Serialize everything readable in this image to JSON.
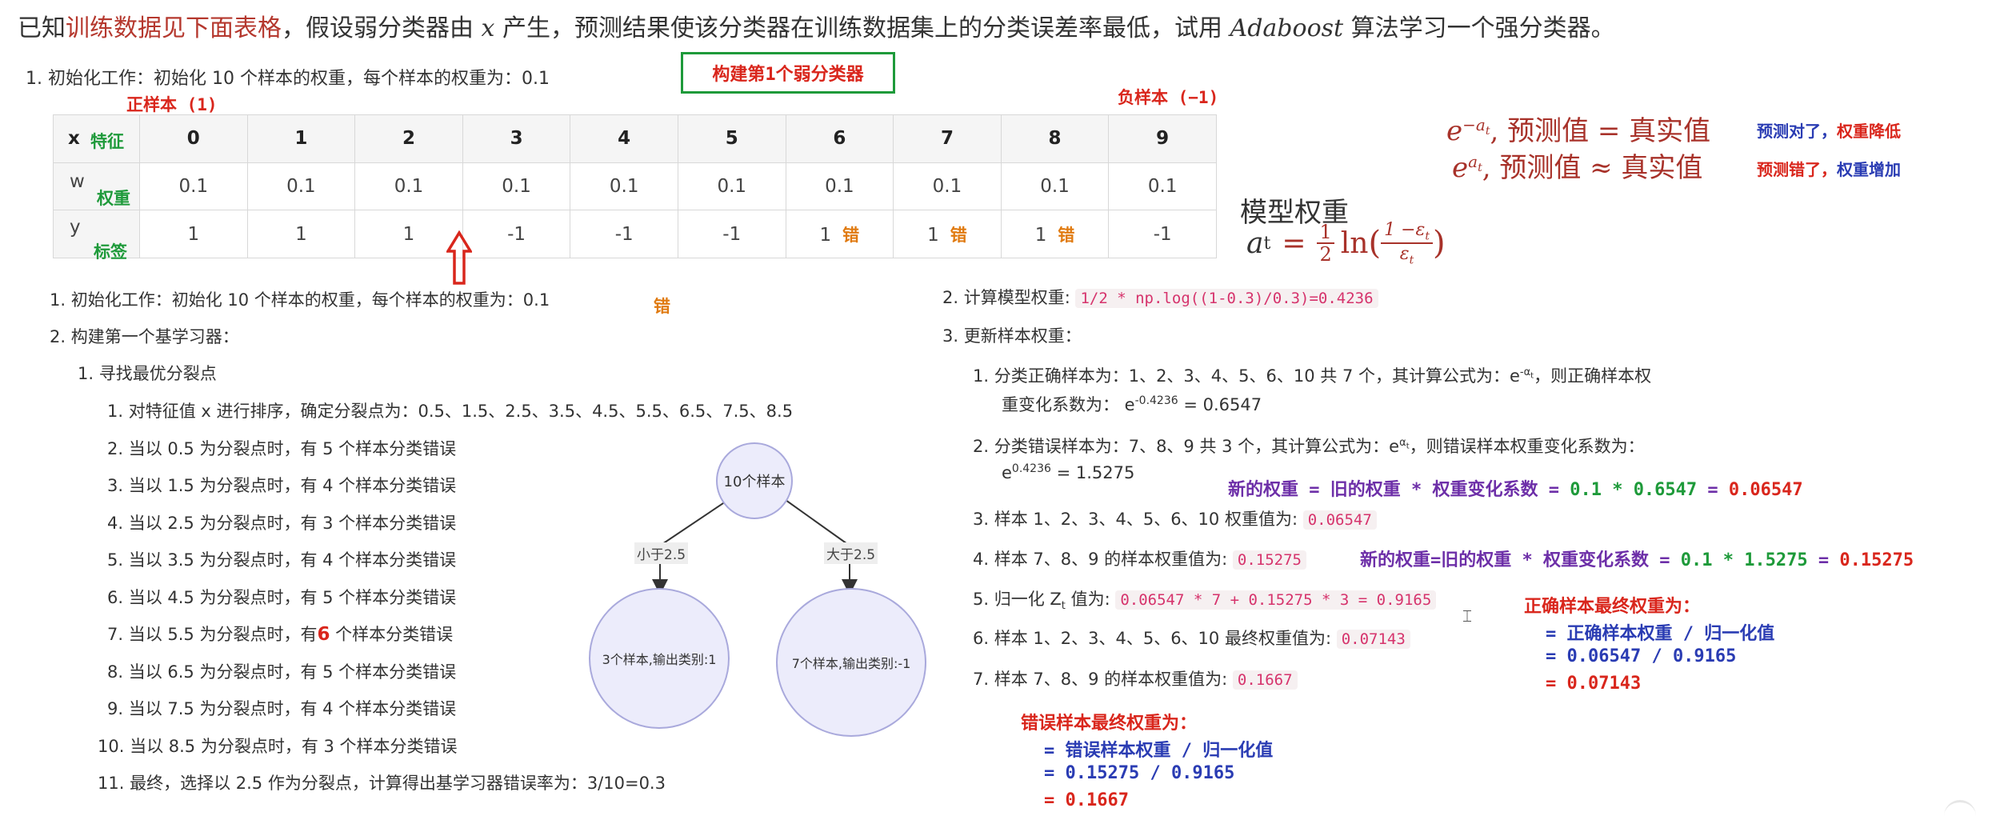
{
  "title": {
    "prefix": "已知",
    "highlight": "训练数据见下面表格",
    "mid": "，假设弱分类器由 ",
    "var": "x",
    "suffix": " 产生，预测结果使该分类器在训练数据集上的分类误差率最低，试用 ",
    "algo": "Adaboost",
    "end": " 算法学习一个强分类器。"
  },
  "init_line": "1.  初始化工作：初始化 10 个样本的权重，每个样本的权重为：0.1",
  "box_label": "构建第1个弱分类器",
  "pos_sample": "正样本 (1)",
  "neg_sample": "负样本 (−1)",
  "table": {
    "row_heads": [
      {
        "sym": "x",
        "label": "特征"
      },
      {
        "sym": "w",
        "label": "权重"
      },
      {
        "sym": "y",
        "label": "标签"
      }
    ],
    "x": [
      "0",
      "1",
      "2",
      "3",
      "4",
      "5",
      "6",
      "7",
      "8",
      "9"
    ],
    "w": [
      "0.1",
      "0.1",
      "0.1",
      "0.1",
      "0.1",
      "0.1",
      "0.1",
      "0.1",
      "0.1",
      "0.1"
    ],
    "y": [
      "1",
      "1",
      "1",
      "-1",
      "-1",
      "-1",
      "1",
      "1",
      "1",
      "-1"
    ],
    "wrong_mark": "错"
  },
  "stray_wrong": "错",
  "left_steps": {
    "s1": "1.  初始化工作：初始化 10 个样本的权重，每个样本的权重为：0.1",
    "s2": "2.  构建第一个基学习器：",
    "s2_1": "1.  寻找最优分裂点",
    "items": [
      "1.  对特征值 x 进行排序，确定分裂点为：0.5、1.5、2.5、3.5、4.5、5.5、6.5、7.5、8.5",
      "2.  当以 0.5 为分裂点时，有 5 个样本分类错误",
      "3.  当以 1.5 为分裂点时，有 4 个样本分类错误",
      "4.  当以 2.5 为分裂点时，有 3 个样本分类错误",
      "5.  当以 3.5 为分裂点时，有 4 个样本分类错误",
      "6.  当以 4.5 为分裂点时，有 5 个样本分类错误",
      "7.  当以 5.5 为分裂点时，有",
      "8.  当以 6.5 为分裂点时，有 5 个样本分类错误",
      "9.  当以 7.5 为分裂点时，有 4 个样本分类错误",
      "10.  当以 8.5 为分裂点时，有 3 个样本分类错误",
      "11.  最终，选择以 2.5 作为分裂点，计算得出基学习器错误率为：3/10=0.3"
    ],
    "item7_num": "6",
    "item7_rest": " 个样本分类错误"
  },
  "tree": {
    "root": "10个样本",
    "left_edge": "小于2.5",
    "right_edge": "大于2.5",
    "left_leaf": "3个样本,输出类别:1",
    "right_leaf": "7个样本,输出类别:-1"
  },
  "weight_rules": {
    "r1_expr": "e",
    "r1_sup": "−a",
    "r1_sub": "t",
    "r1_text": ", 预测值 = 真实值",
    "r1_note_a": "预测对了，",
    "r1_note_b": "权重降低",
    "r2_expr": "e",
    "r2_sup": "a",
    "r2_sub": "t",
    "r2_text": ", 预测值 ≈ 真实值",
    "r2_note_a": "预测错了，",
    "r2_note_b": "权重增加"
  },
  "model_weight": {
    "label": "模型权重",
    "lhs": "a",
    "lhs_sub": "t",
    "eq": "=",
    "half_num": "1",
    "half_den": "2",
    "ln": "ln",
    "frac_num": "1 −ε",
    "frac_num_sub": "t",
    "frac_den": "ε",
    "frac_den_sub": "t"
  },
  "right_steps": {
    "s2": "2.  计算模型权重:",
    "s2_code": "1/2 * np.log((1-0.3)/0.3)=0.4236",
    "s3": "3.  更新样本权重：",
    "i1_a": "1.  分类正确样本为：1、2、3、4、5、6、10 共 7 个，其计算公式为：e",
    "i1_sup": "-α",
    "i1_sub": "t",
    "i1_b": "，则正确样本权",
    "i1_c": "重变化系数为：  e",
    "i1_c_sup": "-0.4236",
    "i1_c_end": " = 0.6547",
    "i2_a": "2.  分类错误样本为：7、8、9 共 3 个，其计算公式为：e",
    "i2_sup": "α",
    "i2_sub": "t",
    "i2_b": "，则错误样本权重变化系数为：",
    "i2_c": "e",
    "i2_c_sup": "0.4236",
    "i2_c_end": " = 1.5275",
    "i3": "3.  样本 1、2、3、4、5、6、10  权重值为:",
    "i3_code": "0.06547",
    "i4": "4.  样本 7、8、9 的样本权重值为:",
    "i4_code": "0.15275",
    "i5": "5.  归一化 Z",
    "i5_sub": "t",
    "i5_b": " 值为:",
    "i5_code": "0.06547 * 7 + 0.15275 * 3 = 0.9165",
    "i6": "6.  样本 1、2、3、4、5、6、10  最终权重值为:",
    "i6_code": "0.07143",
    "i7": "7.  样本 7、8、9 的样本权重值为:",
    "i7_code": "0.1667"
  },
  "notes": {
    "n1_a": "新的权重 = 旧的权重 * 权重变化系数 = ",
    "n1_b": "0.1 * 0.6547",
    "n1_c": " = ",
    "n1_d": "0.06547",
    "n2_a": "新的权重=旧的权重 * 权重变化系数 = ",
    "n2_b": "0.1 * 1.5275",
    "n2_c": " = ",
    "n2_d": "0.15275",
    "correct_title": "正确样本最终权重为：",
    "correct_l1": "= 正确样本权重 / 归一化值",
    "correct_l2": "= 0.06547 / 0.9165",
    "correct_l3": "= 0.07143",
    "wrong_title": "错误样本最终权重为：",
    "wrong_l1": "= 错误样本权重 / 归一化值",
    "wrong_l2": "= 0.15275 / 0.9165",
    "wrong_l3": "= 0.1667"
  }
}
